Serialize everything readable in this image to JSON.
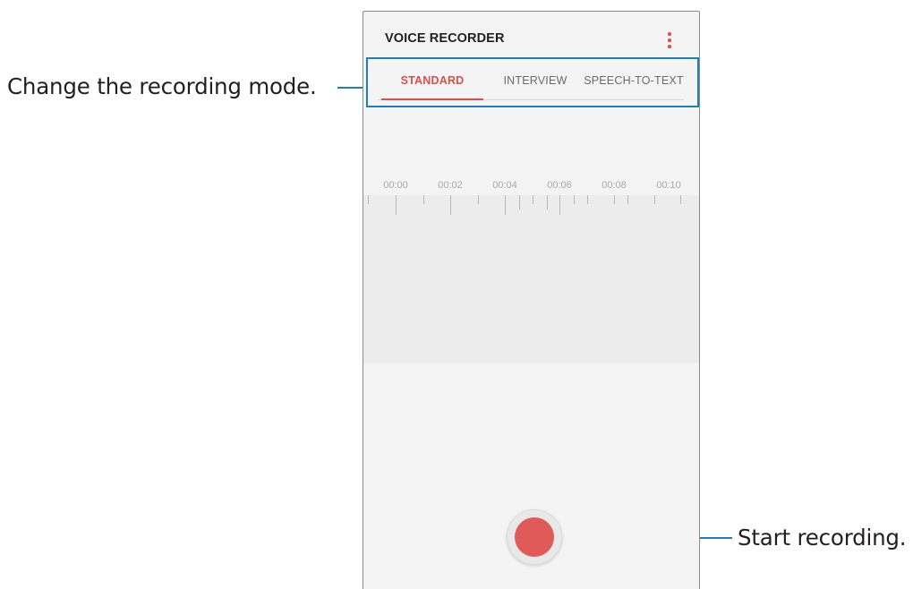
{
  "callouts": {
    "mode": "Change the recording mode.",
    "record": "Start recording."
  },
  "app": {
    "title": "VOICE RECORDER",
    "more_icon": "more-vert-icon",
    "accent_color": "#d8504b",
    "callout_color": "#1a7fc1"
  },
  "tabs": [
    {
      "label": "STANDARD",
      "active": true
    },
    {
      "label": "INTERVIEW",
      "active": false
    },
    {
      "label": "SPEECH-TO-TEXT",
      "active": false
    }
  ],
  "timeline": {
    "labels": [
      "00:00",
      "00:02",
      "00:04",
      "00:06",
      "00:08",
      "00:10"
    ]
  },
  "record_button": {
    "icon": "record-icon"
  }
}
